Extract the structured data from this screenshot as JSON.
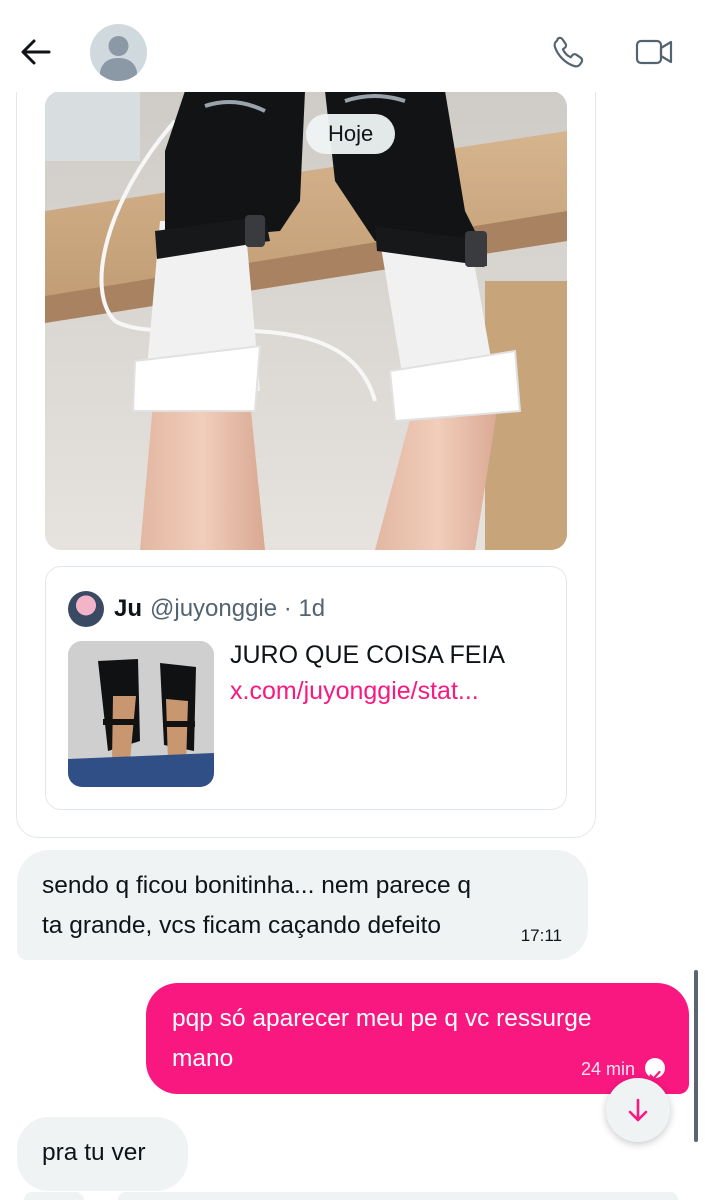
{
  "header": {
    "back_icon": "arrow-left-icon",
    "avatar": "default-avatar",
    "phone_icon": "phone-icon",
    "video_icon": "video-camera-icon"
  },
  "date_separator": "Hoje",
  "shared_post": {
    "image": "photo-legs-white-lace-socks-black-mary-jane-shoes",
    "quote": {
      "name": "Ju",
      "handle": "@juyonggie · 1d",
      "text": "JURO QUE COISA FEIA",
      "link": "x.com/juyonggie/stat..."
    }
  },
  "messages": [
    {
      "direction": "in",
      "text_lines": [
        "sendo q ficou bonitinha... nem parece q",
        "ta grande, vcs ficam caçando defeito"
      ],
      "time": "17:11"
    },
    {
      "direction": "out",
      "text_lines": [
        "pqp só aparecer meu pe q vc ressurge",
        "mano"
      ],
      "time": "24 min",
      "status_icon": "check-circle-icon"
    },
    {
      "direction": "in",
      "text_lines": [
        "pra tu ver"
      ]
    }
  ],
  "scroll_button_icon": "arrow-down-icon",
  "colors": {
    "accent": "#f91880",
    "incoming_bubble": "#eff3f4",
    "text": "#0f1419",
    "muted": "#536471"
  }
}
